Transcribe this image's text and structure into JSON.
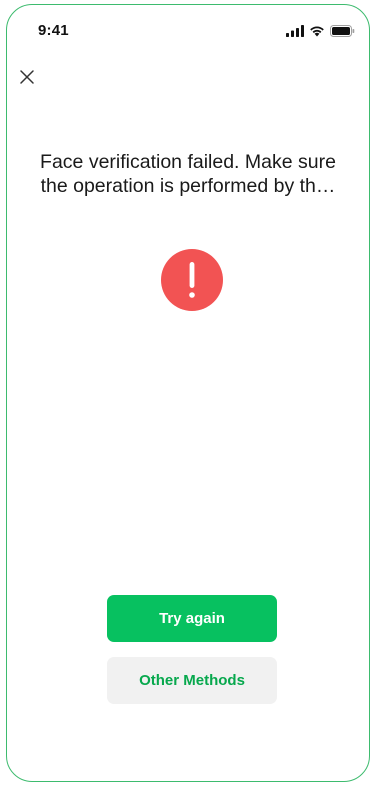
{
  "status_bar": {
    "time": "9:41",
    "icons": [
      "signal-icon",
      "wifi-icon",
      "battery-icon"
    ]
  },
  "header": {
    "close_icon": "close-icon"
  },
  "message": {
    "line1": "Face verification failed. Make sure",
    "line2": "the operation is performed by th…"
  },
  "status_icon": {
    "name": "exclamation-alert-icon",
    "color": "#f25353"
  },
  "actions": {
    "primary_label": "Try again",
    "secondary_label": "Other Methods"
  },
  "colors": {
    "accent": "#07c160",
    "secondary_text": "#07a84d",
    "secondary_bg": "#f1f1f1",
    "alert": "#f25353",
    "frame_border": "#3dbb6e"
  }
}
